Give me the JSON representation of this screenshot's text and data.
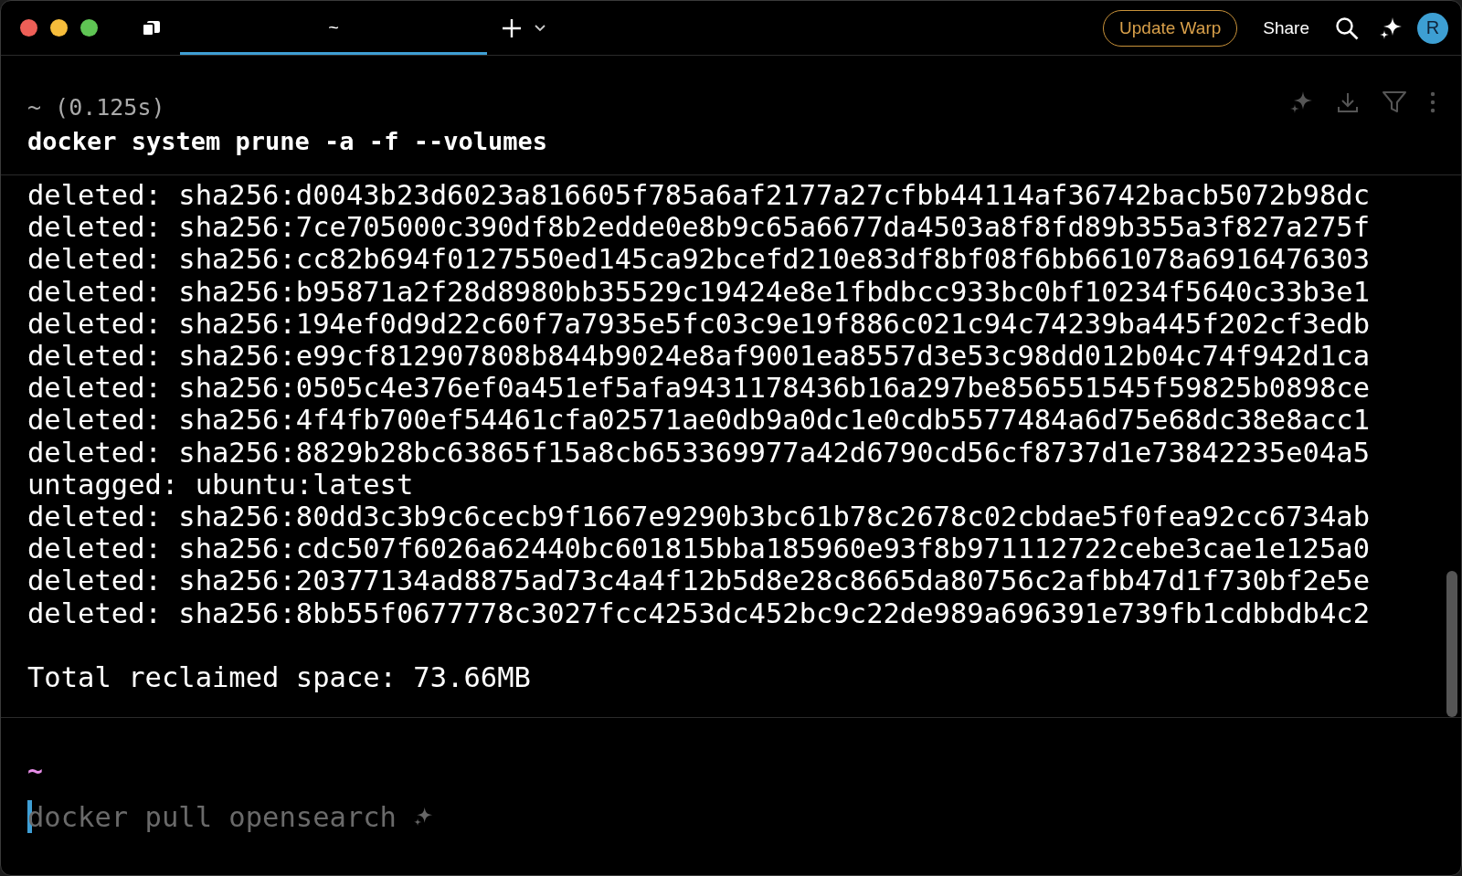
{
  "tabs": [
    {
      "label": "~",
      "selected": true
    }
  ],
  "update_button": "Update Warp",
  "share_button": "Share",
  "avatar": "R",
  "block": {
    "header": "~ (0.125s)",
    "command": "docker system prune -a -f --volumes",
    "output_lines": [
      "deleted: sha256:d0043b23d6023a816605f785a6af2177a27cfbb44114af36742bacb5072b98dc",
      "deleted: sha256:7ce705000c390df8b2edde0e8b9c65a6677da4503a8f8fd89b355a3f827a275f",
      "deleted: sha256:cc82b694f0127550ed145ca92bcefd210e83df8bf08f6bb661078a6916476303",
      "deleted: sha256:b95871a2f28d8980bb35529c19424e8e1fbdbcc933bc0bf10234f5640c33b3e1",
      "deleted: sha256:194ef0d9d22c60f7a7935e5fc03c9e19f886c021c94c74239ba445f202cf3edb",
      "deleted: sha256:e99cf812907808b844b9024e8af9001ea8557d3e53c98dd012b04c74f942d1ca",
      "deleted: sha256:0505c4e376ef0a451ef5afa9431178436b16a297be856551545f59825b0898ce",
      "deleted: sha256:4f4fb700ef54461cfa02571ae0db9a0dc1e0cdb5577484a6d75e68dc38e8acc1",
      "deleted: sha256:8829b28bc63865f15a8cb653369977a42d6790cd56cf8737d1e73842235e04a5",
      "untagged: ubuntu:latest",
      "deleted: sha256:80dd3c3b9c6cecb9f1667e9290b3bc61b78c2678c02cbdae5f0fea92cc6734ab",
      "deleted: sha256:cdc507f6026a62440bc601815bba185960e93f8b971112722cebe3cae1e125a0",
      "deleted: sha256:20377134ad8875ad73c4a4f12b5d8e28c8665da80756c2afbb47d1f730bf2e5e",
      "deleted: sha256:8bb55f0677778c3027fcc4253dc452bc9c22de989a696391e739fb1cdbbdb4c2"
    ],
    "summary": "Total reclaimed space: 73.66MB"
  },
  "prompt": {
    "directory": "~",
    "placeholder": "docker pull opensearch"
  }
}
